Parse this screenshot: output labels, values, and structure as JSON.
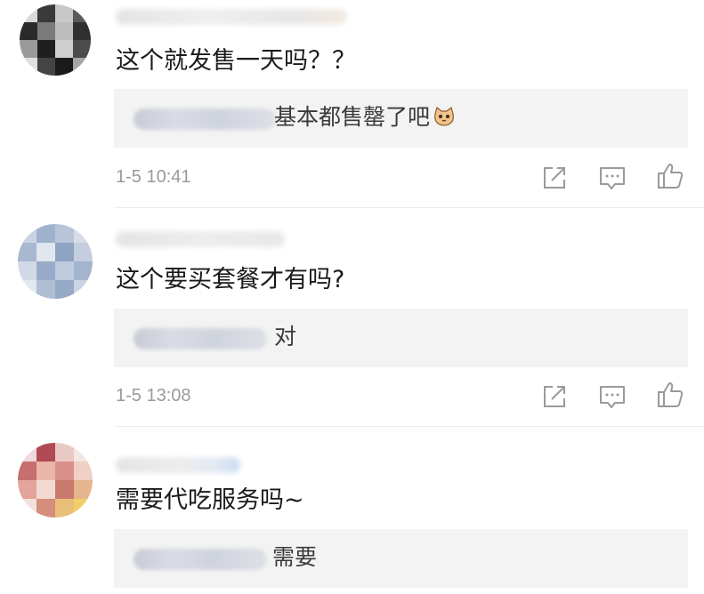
{
  "colors": {
    "reply_bg": "#f3f3f3",
    "text_main": "#1a1a1a",
    "text_meta": "#9a9a9a",
    "icon": "#9a9a9a"
  },
  "icons": {
    "share": "share-icon",
    "comment": "comment-icon",
    "like": "thumbs-up-icon",
    "reply_emoji": "cat-face-emoji"
  },
  "comments": [
    {
      "text": "这个就发售一天吗？？",
      "reply_text": "基本都售罄了吧",
      "time": "1-5 10:41"
    },
    {
      "text": "这个要买套餐才有吗?",
      "reply_text": "对",
      "time": "1-5 13:08"
    },
    {
      "text": "需要代吃服务吗~",
      "reply_text": "需要",
      "time": ""
    }
  ]
}
